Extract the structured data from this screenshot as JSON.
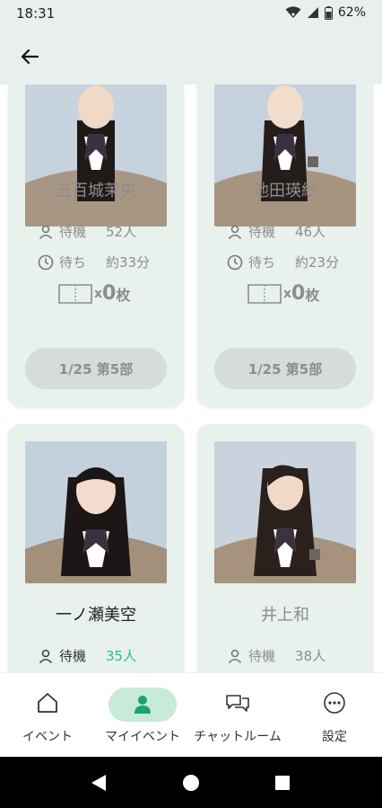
{
  "status_bar": {
    "time": "18:31",
    "battery": "62%"
  },
  "app_bar": {
    "back_icon": "arrow-left-icon"
  },
  "colors": {
    "accent": "#27c08a",
    "card_bg": "#e8f1ec",
    "pill_bg": "#c7ead9"
  },
  "cards": [
    {
      "name": "五百城茉央",
      "wait_label": "待機",
      "wait_value": "52人",
      "time_label": "待ち",
      "time_value": "約33分",
      "ticket_x": "x",
      "ticket_count": "0",
      "ticket_unit": "枚",
      "date": "1/25 第5部"
    },
    {
      "name": "池田瑛紗",
      "wait_label": "待機",
      "wait_value": "46人",
      "time_label": "待ち",
      "time_value": "約23分",
      "ticket_x": "x",
      "ticket_count": "0",
      "ticket_unit": "枚",
      "date": "1/25 第5部"
    },
    {
      "name": "一ノ瀬美空",
      "wait_label": "待機",
      "wait_value": "35人"
    },
    {
      "name": "井上和",
      "wait_label": "待機",
      "wait_value": "38人"
    }
  ],
  "bottom_nav": [
    {
      "label": "イベント",
      "icon": "home-icon"
    },
    {
      "label": "マイイベント",
      "icon": "person-icon"
    },
    {
      "label": "チャットルーム",
      "icon": "chat-icon"
    },
    {
      "label": "設定",
      "icon": "more-icon"
    }
  ]
}
